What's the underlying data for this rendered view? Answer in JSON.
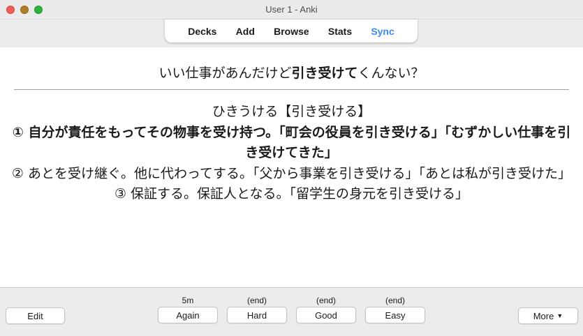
{
  "window": {
    "title": "User 1 - Anki"
  },
  "toolbar": {
    "items": [
      {
        "label": "Decks"
      },
      {
        "label": "Add"
      },
      {
        "label": "Browse"
      },
      {
        "label": "Stats"
      },
      {
        "label": "Sync"
      }
    ],
    "accent_color": "#3b8cf0"
  },
  "card": {
    "question": {
      "before": "いい仕事があんだけど",
      "bold": "引き受けて",
      "after": "くんない？"
    },
    "reading": "ひきうける【引き受ける】",
    "definitions": [
      {
        "text": "① 自分が責任をもってその物事を受け持つ。「町会の役員を引き受ける」「むずかしい仕事を引き受けてきた」",
        "bold": true
      },
      {
        "text": "② あとを受け継ぐ。他に代わってする。「父から事業を引き受ける」「あとは私が引き受けた」",
        "bold": false
      },
      {
        "text": "③ 保証する。保証人となる。「留学生の身元を引き受ける」",
        "bold": false
      }
    ]
  },
  "bottom": {
    "edit_label": "Edit",
    "more_label": "More",
    "answers": [
      {
        "interval": "5m",
        "label": "Again"
      },
      {
        "interval": "(end)",
        "label": "Hard"
      },
      {
        "interval": "(end)",
        "label": "Good"
      },
      {
        "interval": "(end)",
        "label": "Easy"
      }
    ]
  }
}
